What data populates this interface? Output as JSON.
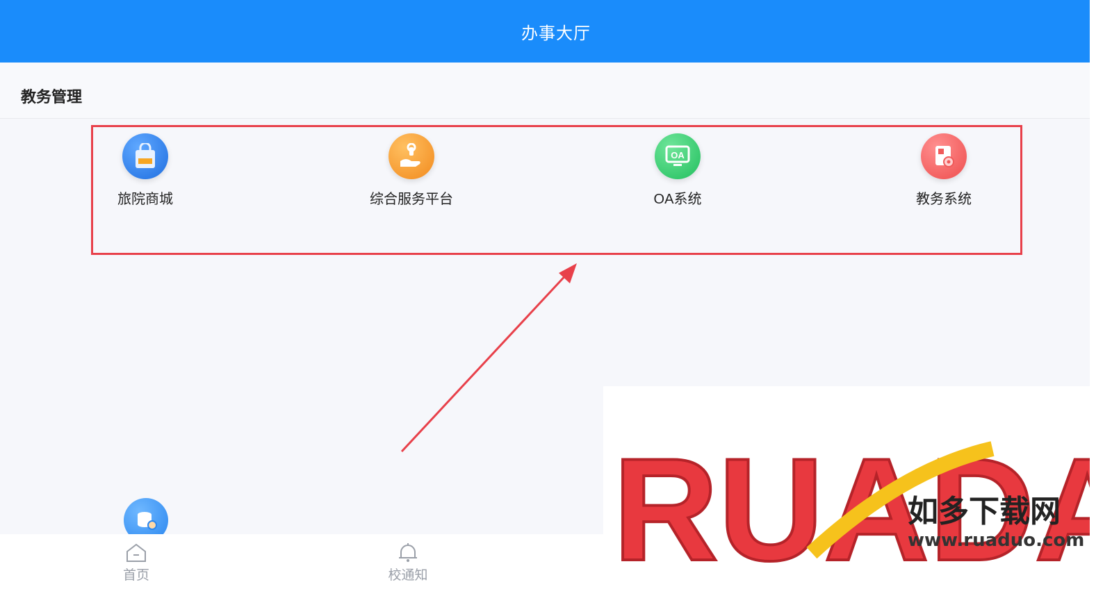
{
  "header": {
    "title": "办事大厅"
  },
  "section": {
    "title": "教务管理"
  },
  "apps": [
    {
      "label": "旅院商城",
      "icon": "shopping-bag-icon",
      "color": "#2f7cf0"
    },
    {
      "label": "综合服务平台",
      "icon": "hand-service-icon",
      "color": "#f59a2e"
    },
    {
      "label": "OA系统",
      "icon": "oa-monitor-icon",
      "color": "#2cc66a",
      "icon_text": "OA"
    },
    {
      "label": "教务系统",
      "icon": "document-gear-icon",
      "color": "#f05a5a"
    }
  ],
  "tabs": [
    {
      "label": "首页",
      "icon": "home-icon"
    },
    {
      "label": "校通知",
      "icon": "bell-icon"
    }
  ],
  "watermark": {
    "logo": "RUADAO",
    "cn_text": "如多下载网",
    "url": "www.ruaduo.com"
  },
  "colors": {
    "header": "#1a8cfb",
    "highlight": "#e8404a"
  }
}
